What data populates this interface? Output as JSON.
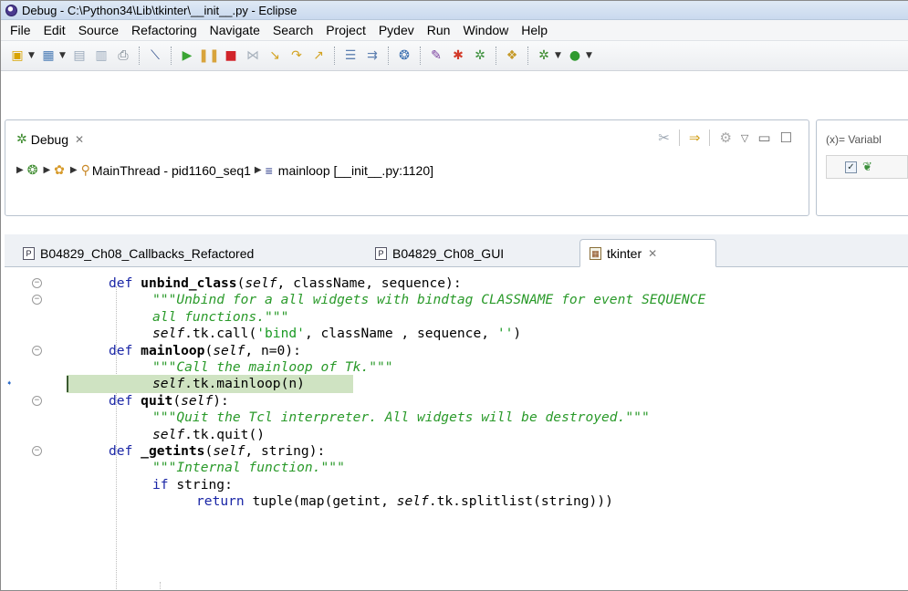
{
  "window": {
    "title": "Debug - C:\\Python34\\Lib\\tkinter\\__init__.py - Eclipse"
  },
  "menu": [
    "File",
    "Edit",
    "Source",
    "Refactoring",
    "Navigate",
    "Search",
    "Project",
    "Pydev",
    "Run",
    "Window",
    "Help"
  ],
  "debug_view": {
    "tab_label": "Debug",
    "close_glyph": "✕",
    "breadcrumb": {
      "thread": "MainThread - pid1160_seq1",
      "frame": "mainloop [__init__.py:1120]"
    }
  },
  "variables_view": {
    "tab_label": "(x)= Variabl"
  },
  "editor": {
    "tabs": [
      {
        "label": "B04829_Ch08_Callbacks_Refactored",
        "icon": "P"
      },
      {
        "label": "B04829_Ch08_GUI",
        "icon": "P"
      },
      {
        "label": "tkinter",
        "icon": "tk",
        "active": true
      }
    ],
    "current_line_index": 6,
    "lines": [
      {
        "indent": 0,
        "fold": true,
        "tokens": [
          [
            "kw",
            "def "
          ],
          [
            "fn",
            "unbind_class"
          ],
          [
            "plain",
            "("
          ],
          [
            "self",
            "self"
          ],
          [
            "plain",
            ", className, sequence):"
          ]
        ]
      },
      {
        "indent": 1,
        "fold": true,
        "tokens": [
          [
            "doc",
            "\"\"\"Unbind for a all widgets with bindtag CLASSNAME for event SEQUENCE"
          ]
        ]
      },
      {
        "indent": 1,
        "fold": false,
        "tokens": [
          [
            "doc",
            "all functions.\"\"\""
          ]
        ]
      },
      {
        "indent": 1,
        "fold": false,
        "tokens": [
          [
            "self",
            "self"
          ],
          [
            "plain",
            ".tk.call("
          ],
          [
            "str",
            "'bind'"
          ],
          [
            "plain",
            ", className , sequence, "
          ],
          [
            "str",
            "''"
          ],
          [
            "plain",
            ")"
          ]
        ]
      },
      {
        "indent": 0,
        "fold": true,
        "tokens": [
          [
            "kw",
            "def "
          ],
          [
            "fn",
            "mainloop"
          ],
          [
            "plain",
            "("
          ],
          [
            "self",
            "self"
          ],
          [
            "plain",
            ", n=0):"
          ]
        ]
      },
      {
        "indent": 1,
        "fold": false,
        "tokens": [
          [
            "doc",
            "\"\"\"Call the mainloop of Tk.\"\"\""
          ]
        ]
      },
      {
        "indent": 1,
        "fold": false,
        "tokens": [
          [
            "self",
            "self"
          ],
          [
            "plain",
            ".tk.mainloop(n)"
          ]
        ]
      },
      {
        "indent": 0,
        "fold": true,
        "tokens": [
          [
            "kw",
            "def "
          ],
          [
            "fn",
            "quit"
          ],
          [
            "plain",
            "("
          ],
          [
            "self",
            "self"
          ],
          [
            "plain",
            "):"
          ]
        ]
      },
      {
        "indent": 1,
        "fold": false,
        "tokens": [
          [
            "doc",
            "\"\"\"Quit the Tcl interpreter. All widgets will be destroyed.\"\"\""
          ]
        ]
      },
      {
        "indent": 1,
        "fold": false,
        "tokens": [
          [
            "self",
            "self"
          ],
          [
            "plain",
            ".tk.quit()"
          ]
        ]
      },
      {
        "indent": 0,
        "fold": true,
        "tokens": [
          [
            "kw",
            "def "
          ],
          [
            "fn",
            "_getints"
          ],
          [
            "plain",
            "("
          ],
          [
            "self",
            "self"
          ],
          [
            "plain",
            ", string):"
          ]
        ]
      },
      {
        "indent": 1,
        "fold": false,
        "tokens": [
          [
            "doc",
            "\"\"\"Internal function.\"\"\""
          ]
        ]
      },
      {
        "indent": 1,
        "fold": false,
        "tokens": [
          [
            "kw",
            "if "
          ],
          [
            "plain",
            "string:"
          ]
        ]
      },
      {
        "indent": 2,
        "fold": false,
        "tokens": [
          [
            "kw",
            "return "
          ],
          [
            "plain",
            "tuple(map(getint, "
          ],
          [
            "self",
            "self"
          ],
          [
            "plain",
            ".tk.splitlist(string)))"
          ]
        ]
      }
    ]
  },
  "colors": {
    "current_line": "#cfe3c2",
    "keyword": "#1a26a6",
    "docstring": "#2a9a2a",
    "string": "#1a9a24"
  }
}
